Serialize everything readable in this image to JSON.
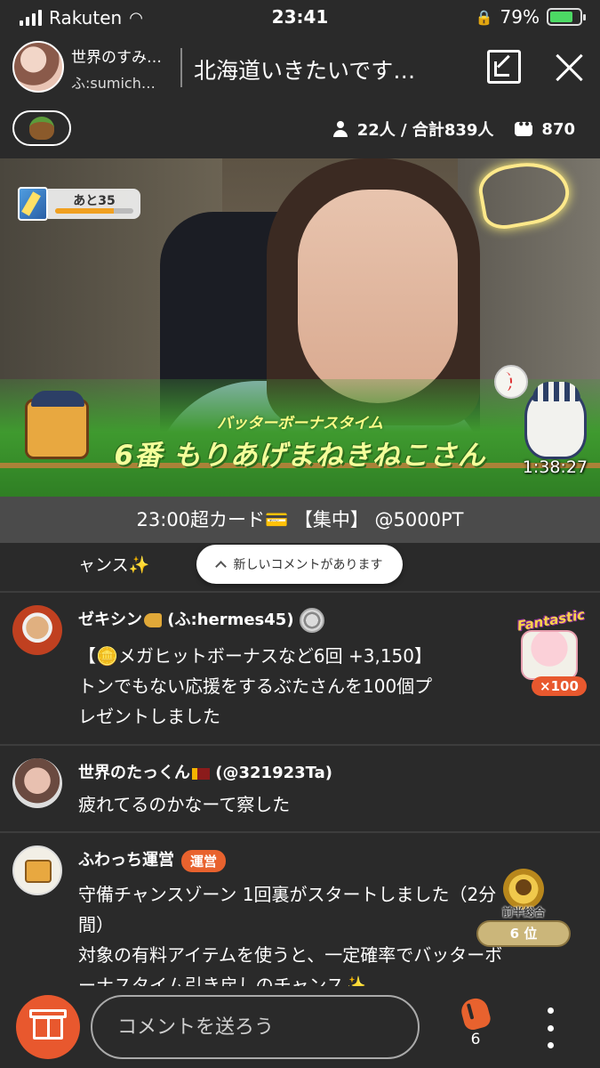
{
  "status_bar": {
    "carrier": "Rakuten",
    "time": "23:41",
    "battery": "79%",
    "battery_level": 0.79
  },
  "header": {
    "host_name": "世界のすみ…",
    "host_id": "ふ:sumich…",
    "room_title": "北海道いきたいです…"
  },
  "info": {
    "viewers": "22人 / 合計839人",
    "comment_count": "870"
  },
  "video": {
    "progress_label": "あと35",
    "progress_fraction": 0.75,
    "bonus_subtitle": "バッターボーナスタイム",
    "bonus_title": "6番  もりあげまねきねこさん",
    "timer": "1:38:27"
  },
  "announcement": "23:00超カード💳 【集中】 @5000PT",
  "comments": {
    "prev_tail": "ャンス✨",
    "new_comment_notice": "新しいコメントがあります",
    "items": [
      {
        "name": "ゼキシン",
        "handle": " (ふ:hermes45)",
        "lines": [
          "【🪙メガヒットボーナスなど6回 +3,150】",
          "トンでもない応援をするぶたさんを100個プ",
          "レゼントしました"
        ],
        "gift_label": "Fantastic",
        "gift_count": "×100"
      },
      {
        "name": "世界のたっくん",
        "handle": " (@321923Ta)",
        "lines": [
          "疲れてるのかなーて察した"
        ]
      },
      {
        "name": "ふわっち運営",
        "badge": "運営",
        "lines": [
          "守備チャンスゾーン 1回裏がスタートしました（2分",
          "間）",
          "対象の有料アイテムを使うと、一定確率でバッターボ",
          "ーナスタイム引き戻しのチャンス✨"
        ]
      }
    ]
  },
  "rank": {
    "label": "前半総合",
    "position": "6 位"
  },
  "bottom": {
    "comment_placeholder": "コメントを送ろう",
    "clap_count": "6"
  }
}
